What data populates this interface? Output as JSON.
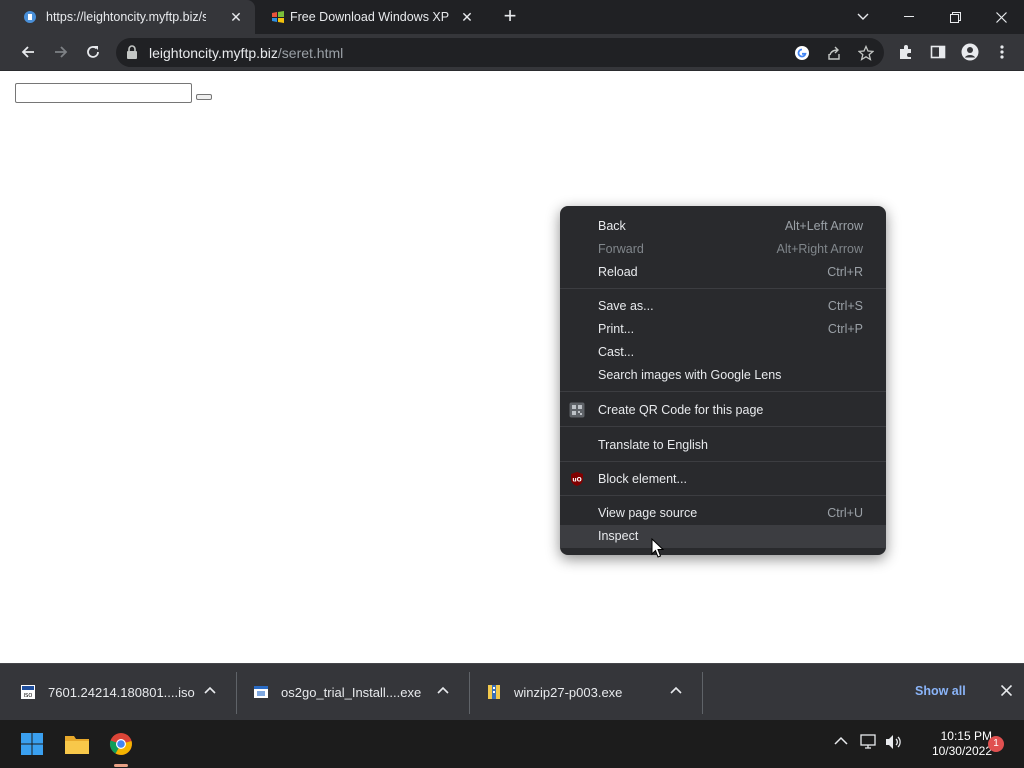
{
  "browser": {
    "tabs": [
      {
        "title": "https://leightoncity.myftp.biz/seret.html",
        "active": true
      },
      {
        "title": "Free Download Windows XP ISO",
        "active": false
      }
    ],
    "new_tab_symbol": "+",
    "tab_close_symbol": "✕",
    "address": {
      "host": "leightoncity.myftp.biz",
      "path": "/seret.html"
    }
  },
  "context_menu": {
    "groups": [
      [
        {
          "label": "Back",
          "shortcut": "Alt+Left Arrow",
          "disabled": false
        },
        {
          "label": "Forward",
          "shortcut": "Alt+Right Arrow",
          "disabled": true
        },
        {
          "label": "Reload",
          "shortcut": "Ctrl+R",
          "disabled": false
        }
      ],
      [
        {
          "label": "Save as...",
          "shortcut": "Ctrl+S",
          "disabled": false
        },
        {
          "label": "Print...",
          "shortcut": "Ctrl+P",
          "disabled": false
        },
        {
          "label": "Cast...",
          "shortcut": "",
          "disabled": false
        },
        {
          "label": "Search images with Google Lens",
          "shortcut": "",
          "disabled": false
        }
      ],
      [
        {
          "label": "Create QR Code for this page",
          "shortcut": "",
          "icon": "qr-code-icon"
        }
      ],
      [
        {
          "label": "Translate to English",
          "shortcut": ""
        }
      ],
      [
        {
          "label": "Block element...",
          "shortcut": "",
          "icon": "ublock-icon"
        }
      ],
      [
        {
          "label": "View page source",
          "shortcut": "Ctrl+U"
        },
        {
          "label": "Inspect",
          "shortcut": "",
          "hovered": true
        }
      ]
    ]
  },
  "downloads": {
    "items": [
      {
        "name": "7601.24214.180801....iso",
        "icon": "disc-image-icon"
      },
      {
        "name": "os2go_trial_Install....exe",
        "icon": "installer-icon"
      },
      {
        "name": "winzip27-p003.exe",
        "icon": "winzip-icon"
      }
    ],
    "show_all": "Show all"
  },
  "taskbar": {
    "time": "10:15 PM",
    "date": "10/30/2022",
    "notification_count": "1"
  },
  "colors": {
    "tabstrip": "#202124",
    "toolbar": "#35363a",
    "menu_bg": "#292a2d",
    "link_blue": "#8ab4f8"
  }
}
